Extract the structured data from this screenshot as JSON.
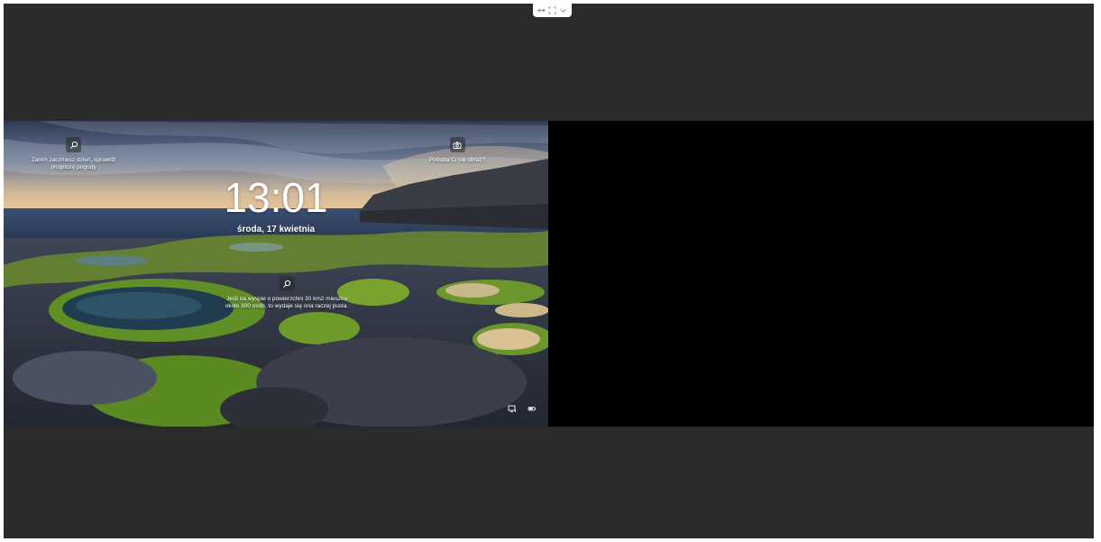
{
  "toolbar": {
    "icons": [
      "resize-horizontal-icon",
      "fullscreen-icon",
      "chevron-down-icon"
    ]
  },
  "lockscreen": {
    "time": "13:01",
    "date": "środa, 17 kwietnia",
    "widgets": [
      {
        "icon": "search-icon",
        "text": "Zanim zaczniesz dzień, sprawdź prognozę pogody"
      },
      {
        "icon": "camera-icon",
        "text": "Podoba Ci się obraz?"
      },
      {
        "icon": "search-icon",
        "text": "Jeśli na wyspie o powierzchni 30 km2 mieszka około 300 osób, to wydaje się ona raczej pusta."
      }
    ],
    "system_icons": [
      "display-icon",
      "battery-icon"
    ]
  },
  "colors": {
    "viewer_bg": "#2b2b2b",
    "right_pane": "#000000",
    "text": "#ffffff"
  }
}
